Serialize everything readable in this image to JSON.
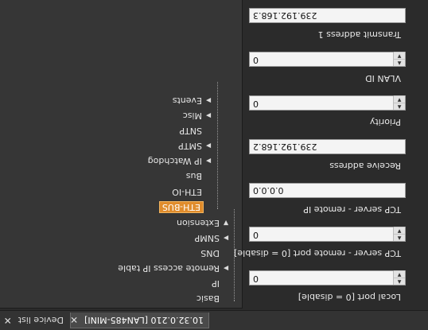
{
  "tabs": [
    {
      "label": "10.32.0.210 [LAN485-MINI]",
      "selected": true
    },
    {
      "label": "Device list",
      "selected": false
    }
  ],
  "tree": {
    "items": [
      {
        "label": "Basic",
        "expandable": false
      },
      {
        "label": "IP",
        "expandable": false
      },
      {
        "label": "Remote access IP table",
        "expandable": true
      },
      {
        "label": "DNS",
        "expandable": false
      },
      {
        "label": "SNMP",
        "expandable": true
      },
      {
        "label": "Extension",
        "expandable": false
      },
      {
        "label": "ETH-BUS",
        "expandable": false,
        "selected": true
      },
      {
        "label": "ETH-IO",
        "expandable": false
      },
      {
        "label": "Bus",
        "expandable": false
      },
      {
        "label": "IP Watchdog",
        "expandable": true
      },
      {
        "label": "SMTP",
        "expandable": true
      },
      {
        "label": "SNTP",
        "expandable": false
      },
      {
        "label": "Misc",
        "expandable": true
      },
      {
        "label": "Events",
        "expandable": true
      }
    ]
  },
  "props": {
    "local_port": {
      "label": "Local port [0 = disable]",
      "value": "0"
    },
    "tcp_port": {
      "label": "TCP server - remote port [0 = disable]",
      "value": "0"
    },
    "tcp_ip": {
      "label": "TCP server - remote IP",
      "value": "0.0.0.0"
    },
    "recv_addr": {
      "label": "Receive address",
      "value": "239.192.168.2"
    },
    "priority": {
      "label": "Priority",
      "value": "0"
    },
    "vlan": {
      "label": "VLAN ID",
      "value": "0"
    },
    "transmit": {
      "label": "Transmit address 1",
      "value": "239.192.168.3"
    }
  },
  "colors": {
    "selected": "#e08c2c",
    "background": "#2b2b2b"
  }
}
